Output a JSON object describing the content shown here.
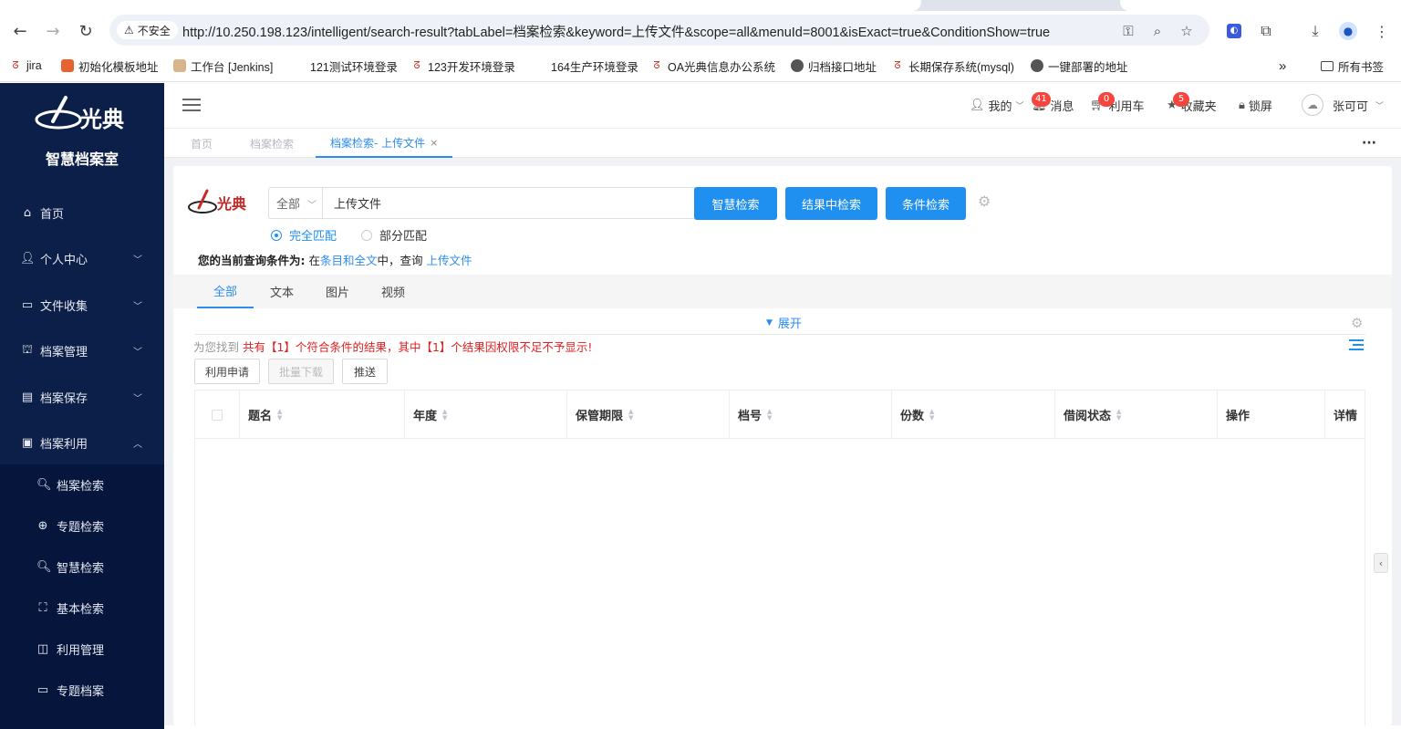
{
  "browser": {
    "security_label": "不安全",
    "url": "http://10.250.198.123/intelligent/search-result?tabLabel=档案检索&keyword=上传文件&scope=all&menuId=8001&isExact=true&ConditionShow=true",
    "bookmarks": [
      {
        "label": "jira"
      },
      {
        "label": "初始化模板地址"
      },
      {
        "label": "工作台 [Jenkins]"
      },
      {
        "label": "121测试环境登录"
      },
      {
        "label": "123开发环境登录"
      },
      {
        "label": "164生产环境登录"
      },
      {
        "label": "OA光典信息办公系统"
      },
      {
        "label": "归档接口地址"
      },
      {
        "label": "长期保存系统(mysql)"
      },
      {
        "label": "一键部署的地址"
      }
    ],
    "all_bookmarks": "所有书签"
  },
  "sidebar": {
    "logo_text": "光典",
    "app_title": "智慧档案室",
    "items": [
      {
        "label": "首页",
        "icon": "home-icon"
      },
      {
        "label": "个人中心",
        "icon": "user-icon"
      },
      {
        "label": "文件收集",
        "icon": "folder-icon"
      },
      {
        "label": "档案管理",
        "icon": "bank-icon"
      },
      {
        "label": "档案保存",
        "icon": "archive-icon"
      },
      {
        "label": "档案利用",
        "icon": "doc-icon"
      }
    ],
    "sub_items": [
      {
        "label": "档案检索",
        "icon": "search-icon"
      },
      {
        "label": "专题检索",
        "icon": "target-icon"
      },
      {
        "label": "智慧检索",
        "icon": "search-icon"
      },
      {
        "label": "基本检索",
        "icon": "scan-icon"
      },
      {
        "label": "利用管理",
        "icon": "book-icon"
      },
      {
        "label": "专题档案",
        "icon": "folder-icon"
      }
    ]
  },
  "header": {
    "mine": "我的",
    "messages": {
      "label": "消息",
      "count": "41"
    },
    "cart": {
      "label": "利用车",
      "count": "0"
    },
    "favorites": {
      "label": "收藏夹",
      "count": "5"
    },
    "lock": "锁屏",
    "user": "张可可"
  },
  "tags": {
    "home": "首页",
    "archive_search": "档案检索",
    "current": "档案检索- 上传文件"
  },
  "search": {
    "logo_text": "光典",
    "scope": "全部",
    "keyword": "上传文件",
    "btn_smart": "智慧检索",
    "btn_in_result": "结果中检索",
    "btn_condition": "条件检索",
    "radio_exact": "完全匹配",
    "radio_partial": "部分匹配"
  },
  "condition": {
    "label": "您的当前查询条件为:",
    "pre": " 在",
    "scope": "条目和全文",
    "mid": "中，查询 ",
    "keyword": "上传文件"
  },
  "type_tabs": [
    "全部",
    "文本",
    "图片",
    "视频"
  ],
  "expand_label": "展开",
  "result": {
    "prefix": "为您找到 ",
    "message": "共有【1】个符合条件的结果，其中【1】个结果因权限不足不予显示!"
  },
  "actions": {
    "apply": "利用申请",
    "batch_download": "批量下载",
    "push": "推送"
  },
  "table": {
    "columns": [
      "题名",
      "年度",
      "保管期限",
      "档号",
      "份数",
      "借阅状态",
      "操作",
      "详情"
    ]
  }
}
